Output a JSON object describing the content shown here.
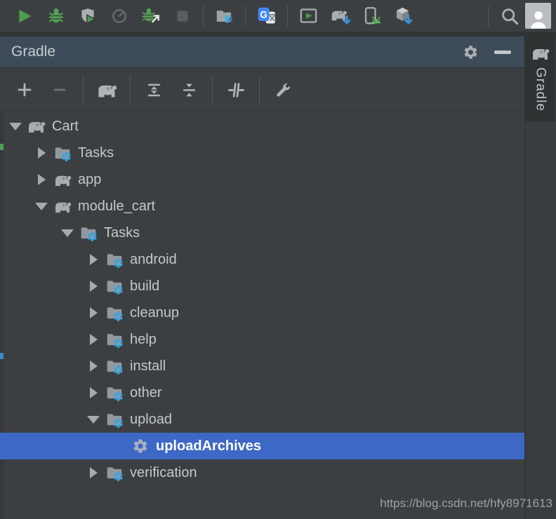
{
  "main_toolbar": {
    "icons": [
      "run",
      "debug",
      "run-with-coverage",
      "profile",
      "attach-debugger-to-android-process",
      "stop",
      "capture",
      "translate",
      "run-anything",
      "sync-project-with-gradle-files",
      "avd-manager",
      "sdk-manager",
      "search-everywhere",
      "user-avatar"
    ]
  },
  "gradle_panel": {
    "title": "Gradle",
    "header_icons": [
      "settings-gear",
      "hide-minimize"
    ],
    "toolbar_icons": [
      "add-gradle-project",
      "remove-gradle-project",
      "refresh-all-gradle-projects",
      "expand-all",
      "collapse-all",
      "toggle-offline-mode",
      "gradle-settings"
    ]
  },
  "side_tab": {
    "label": "Gradle"
  },
  "tree": {
    "rows": [
      {
        "label": "Cart",
        "level": 0,
        "state": "expanded",
        "icon": "gradle-elephant",
        "selected": false
      },
      {
        "label": "Tasks",
        "level": 1,
        "state": "collapsed",
        "icon": "tasks-folder",
        "selected": false
      },
      {
        "label": "app",
        "level": 1,
        "state": "collapsed",
        "icon": "gradle-elephant",
        "selected": false
      },
      {
        "label": "module_cart",
        "level": 1,
        "state": "expanded",
        "icon": "gradle-elephant",
        "selected": false
      },
      {
        "label": "Tasks",
        "level": 2,
        "state": "expanded",
        "icon": "tasks-folder",
        "selected": false
      },
      {
        "label": "android",
        "level": 3,
        "state": "collapsed",
        "icon": "tasks-folder",
        "selected": false
      },
      {
        "label": "build",
        "level": 3,
        "state": "collapsed",
        "icon": "tasks-folder",
        "selected": false
      },
      {
        "label": "cleanup",
        "level": 3,
        "state": "collapsed",
        "icon": "tasks-folder",
        "selected": false
      },
      {
        "label": "help",
        "level": 3,
        "state": "collapsed",
        "icon": "tasks-folder",
        "selected": false
      },
      {
        "label": "install",
        "level": 3,
        "state": "collapsed",
        "icon": "tasks-folder",
        "selected": false
      },
      {
        "label": "other",
        "level": 3,
        "state": "collapsed",
        "icon": "tasks-folder",
        "selected": false
      },
      {
        "label": "upload",
        "level": 3,
        "state": "expanded",
        "icon": "tasks-folder",
        "selected": false
      },
      {
        "label": "uploadArchives",
        "level": 4,
        "state": "leaf",
        "icon": "gradle-task-gear",
        "selected": true
      },
      {
        "label": "verification",
        "level": 3,
        "state": "collapsed",
        "icon": "tasks-folder",
        "selected": false
      }
    ]
  },
  "watermark": {
    "text": "https://blog.csdn.net/hfy8971613"
  },
  "colors": {
    "selection_blue": "#3D68C6",
    "task_gear_blue": "#3BA3DC",
    "run_green": "#4E9C51",
    "header_bg": "#3D4A57",
    "panel_bg": "#3C3F41"
  }
}
